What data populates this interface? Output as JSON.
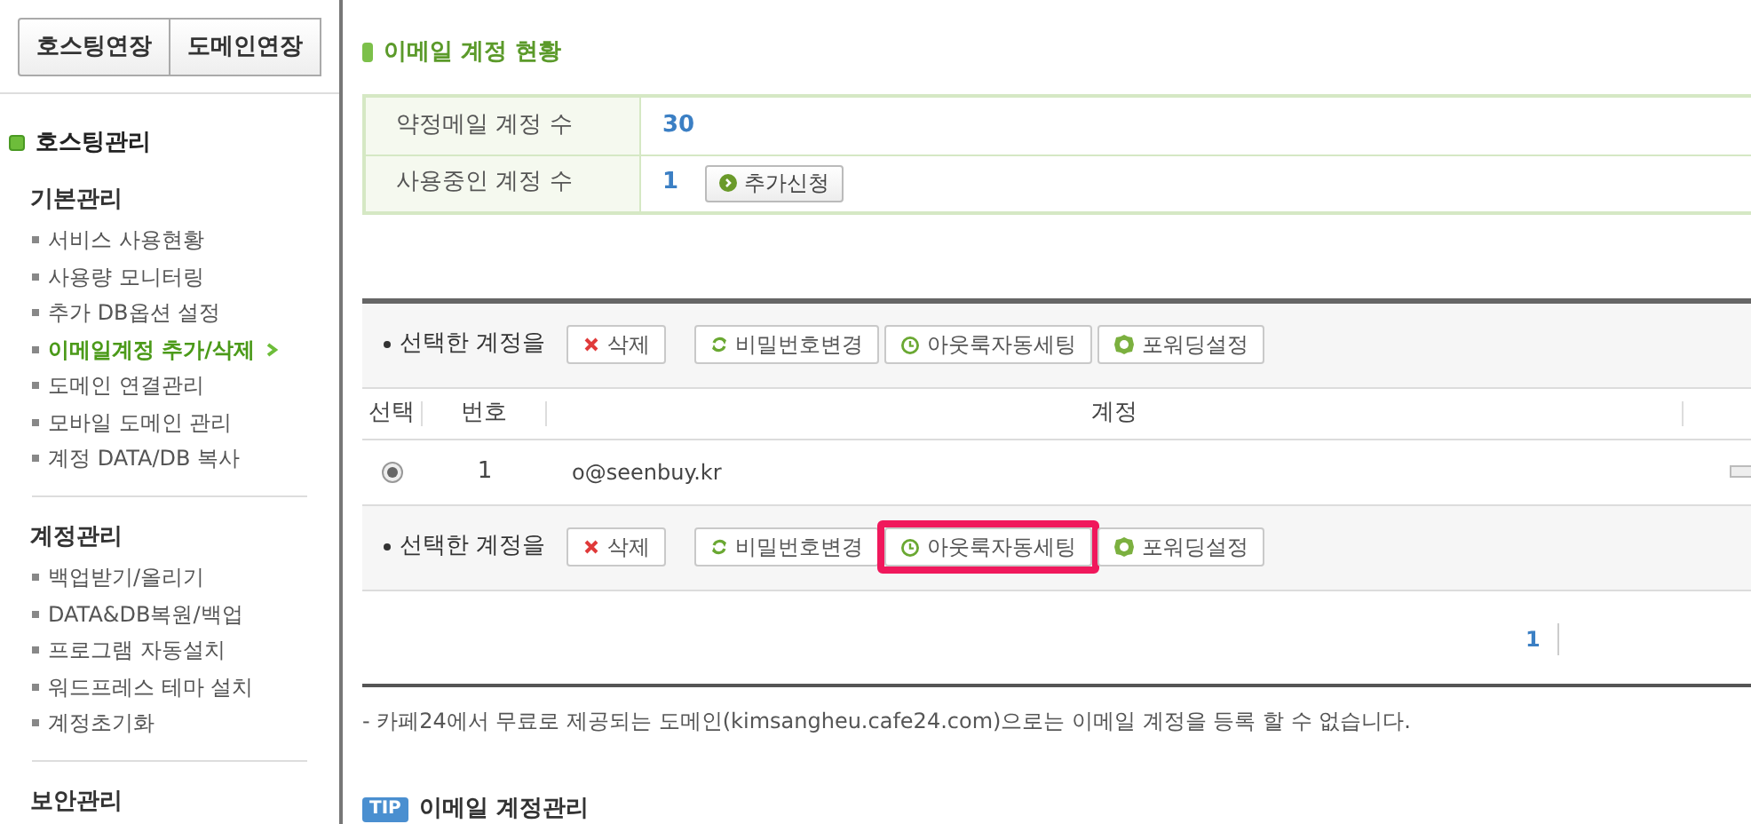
{
  "sidebar": {
    "top_buttons": [
      "호스팅연장",
      "도메인연장"
    ],
    "section_title": "호스팅관리",
    "groups": [
      {
        "title": "기본관리",
        "items": [
          {
            "label": "서비스 사용현황",
            "selected": false
          },
          {
            "label": "사용량 모니터링",
            "selected": false
          },
          {
            "label": "추가 DB옵션 설정",
            "selected": false
          },
          {
            "label": "이메일계정 추가/삭제",
            "selected": true
          },
          {
            "label": "도메인 연결관리",
            "selected": false
          },
          {
            "label": "모바일 도메인 관리",
            "selected": false
          },
          {
            "label": "계정 DATA/DB 복사",
            "selected": false
          }
        ]
      },
      {
        "title": "계정관리",
        "items": [
          {
            "label": "백업받기/올리기",
            "selected": false
          },
          {
            "label": "DATA&DB복원/백업",
            "selected": false
          },
          {
            "label": "프로그램 자동설치",
            "selected": false
          },
          {
            "label": "워드프레스 테마 설치",
            "selected": false
          },
          {
            "label": "계정초기화",
            "selected": false
          }
        ]
      },
      {
        "title": "보안관리"
      }
    ]
  },
  "main": {
    "title": "이메일 계정 현황",
    "summary": [
      {
        "label": "약정메일 계정 수",
        "value": "30"
      },
      {
        "label": "사용중인 계정 수",
        "value": "1",
        "action": "추가신청"
      }
    ],
    "top_toolbar": {
      "label": "선택한 계정을",
      "buttons": [
        {
          "kind": "delete",
          "label": "삭제",
          "highlighted": false
        },
        {
          "kind": "password",
          "label": "비밀번호변경",
          "highlighted": false
        },
        {
          "kind": "outlook",
          "label": "아웃룩자동세팅",
          "highlighted": false
        },
        {
          "kind": "forward",
          "label": "포워딩설정",
          "highlighted": false
        }
      ]
    },
    "table": {
      "columns": [
        "선택",
        "번호",
        "계정"
      ],
      "rows": [
        {
          "selected": true,
          "number": "1",
          "account": "o@seenbuy.kr"
        }
      ]
    },
    "bottom_toolbar": {
      "label": "선택한 계정을",
      "buttons": [
        {
          "kind": "delete",
          "label": "삭제",
          "highlighted": false
        },
        {
          "kind": "password",
          "label": "비밀번호변경",
          "highlighted": false
        },
        {
          "kind": "outlook",
          "label": "아웃룩자동세팅",
          "highlighted": true
        },
        {
          "kind": "forward",
          "label": "포워딩설정",
          "highlighted": false
        }
      ]
    },
    "pagination": [
      {
        "label": "1",
        "selected": true
      }
    ],
    "notice": "- 카페24에서 무료로 제공되는 도메인(kimsangheu.cafe24.com)으로는 이메일 계정을 등록 할 수 없습니다.",
    "tip": {
      "badge": "TIP",
      "title": "이메일 계정관리"
    }
  }
}
